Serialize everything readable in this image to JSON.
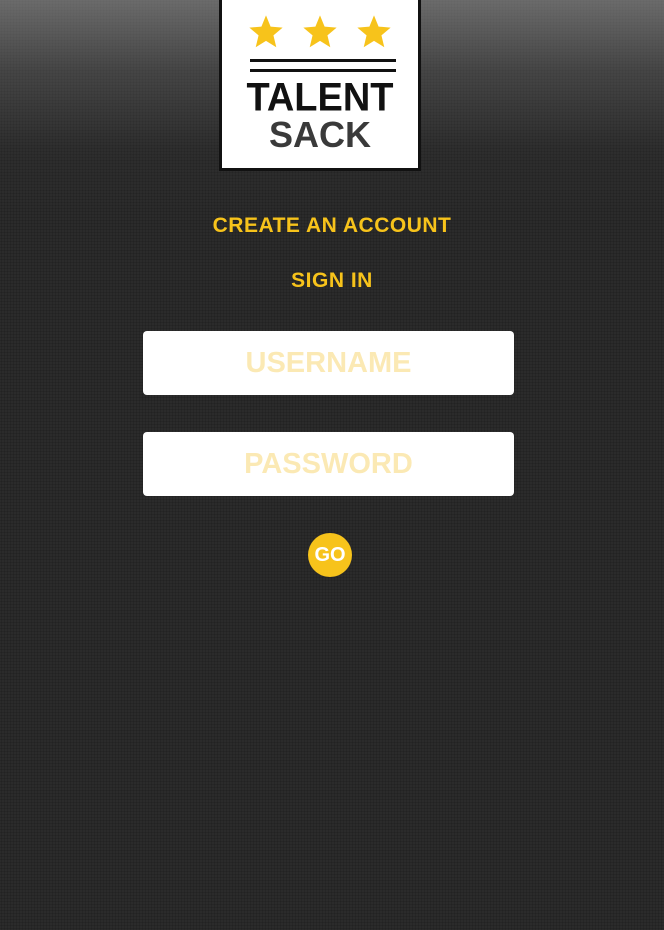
{
  "logo": {
    "line1": "TALENT",
    "line2": "SACK",
    "star_color": "#f7c31b",
    "star_count": 3
  },
  "links": {
    "create_account": "CREATE AN ACCOUNT",
    "sign_in": "SIGN IN"
  },
  "form": {
    "username_placeholder": "USERNAME",
    "password_placeholder": "PASSWORD",
    "username_value": "",
    "password_value": "",
    "go_label": "GO"
  },
  "colors": {
    "accent": "#f7c31b",
    "background": "#2b2b2b",
    "field_bg": "#ffffff",
    "placeholder": "#fbe9b4"
  }
}
